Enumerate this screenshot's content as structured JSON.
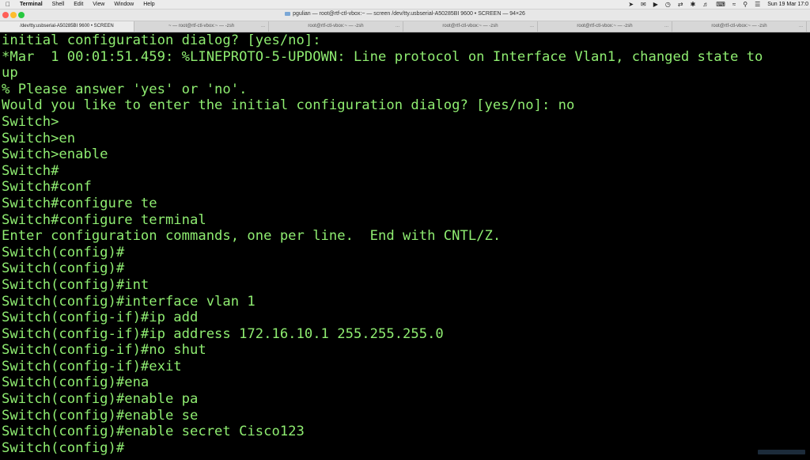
{
  "menubar": {
    "app_name": "Terminal",
    "items": [
      "Shell",
      "Edit",
      "View",
      "Window",
      "Help"
    ],
    "tray_icons": [
      "location-arrow",
      "mail",
      "speaker",
      "clock",
      "arrows",
      "bluetooth",
      "volume",
      "keyboard",
      "wifi",
      "search",
      "control-center"
    ],
    "clock": "Sun 19 Mar  17:0"
  },
  "window": {
    "title": "pgulian — root@rtf-ctl-vbox:~ — screen /dev/tty.usbserial-A50285BI 9600 • SCREEN — 94×26"
  },
  "tabs": [
    {
      "label": "/dev/tty.usbserial-A50285BI 9600 • SCREEN",
      "active": true
    },
    {
      "label": "~ — root@rtf-ctl-vbox:~ — -zsh",
      "active": false
    },
    {
      "label": "root@rtf-ctl-vbox:~ — -zsh",
      "active": false
    },
    {
      "label": "root@rtf-ctl-vbox:~ — -zsh",
      "active": false
    },
    {
      "label": "root@rtf-ctl-vbox:~ — -zsh",
      "active": false
    },
    {
      "label": "root@rtf-ctl-vbox:~ — -zsh",
      "active": false
    }
  ],
  "tab_more": "...",
  "terminal": {
    "text_color": "#8fed71",
    "background": "#000000",
    "lines": [
      "initial configuration dialog? [yes/no]:",
      "*Mar  1 00:01:51.459: %LINEPROTO-5-UPDOWN: Line protocol on Interface Vlan1, changed state to",
      "up",
      "% Please answer 'yes' or 'no'.",
      "Would you like to enter the initial configuration dialog? [yes/no]: no",
      "Switch>",
      "Switch>en",
      "Switch>enable",
      "Switch#",
      "Switch#conf",
      "Switch#configure te",
      "Switch#configure terminal",
      "Enter configuration commands, one per line.  End with CNTL/Z.",
      "Switch(config)#",
      "Switch(config)#",
      "Switch(config)#int",
      "Switch(config)#interface vlan 1",
      "Switch(config-if)#ip add",
      "Switch(config-if)#ip address 172.16.10.1 255.255.255.0",
      "Switch(config-if)#no shut",
      "Switch(config-if)#exit",
      "Switch(config)#ena",
      "Switch(config)#enable pa",
      "Switch(config)#enable se",
      "Switch(config)#enable secret Cisco123",
      "Switch(config)#"
    ]
  }
}
